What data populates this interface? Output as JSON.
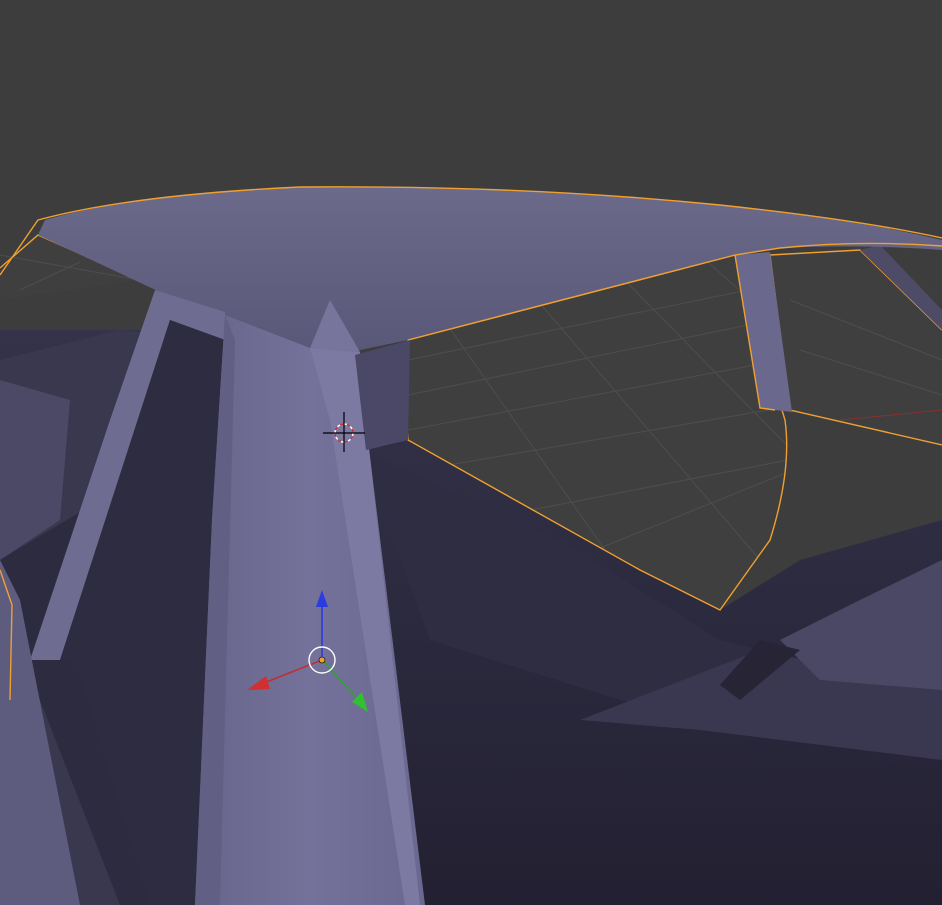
{
  "viewport": {
    "background": "#3d3d3d",
    "grid_color": "#4e4e4e",
    "selection_outline_color": "#f0a030",
    "mesh_color": "#6e6c8c",
    "x_axis_color": "#b03030",
    "y_axis_color": "#30b030",
    "z_axis_color": "#2a3ce0",
    "cursor_icon": "3d-cursor-icon",
    "manipulator_icon": "transform-manipulator-icon",
    "origin_icon": "object-origin-icon"
  }
}
